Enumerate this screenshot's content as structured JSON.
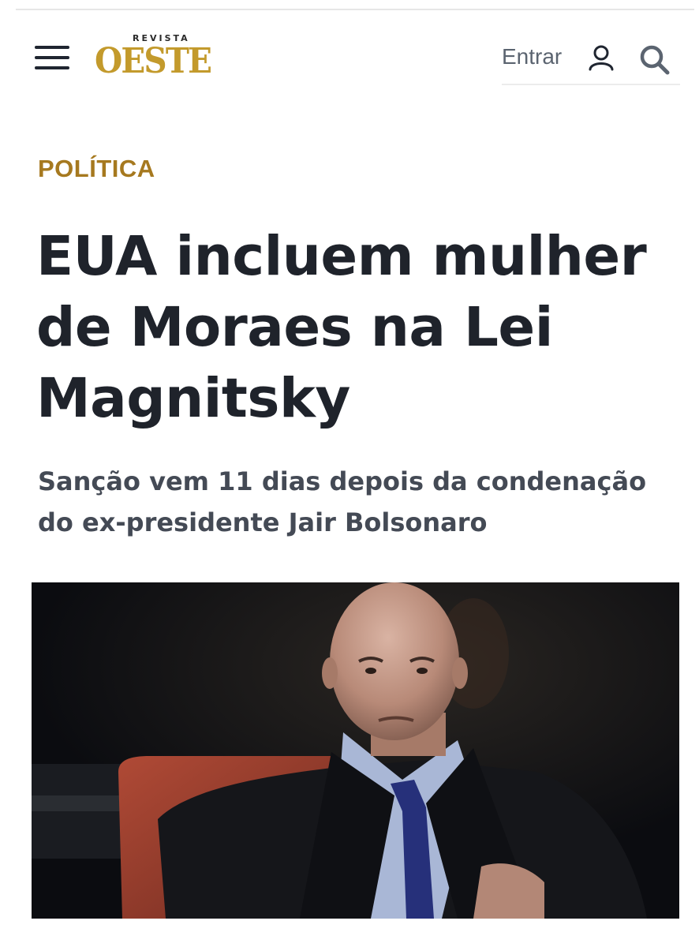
{
  "header": {
    "logo_kicker": "REVISTA",
    "logo_word": "OESTE",
    "signin_label": "Entrar",
    "icons": {
      "menu": "hamburger-menu-icon",
      "user": "user-icon",
      "search": "search-icon"
    }
  },
  "article": {
    "category": "POLÍTICA",
    "headline": "EUA incluem mulher de Moraes na Lei Magnitsky",
    "subtitle": "Sanção vem 11 dias depois da condenação do ex-presidente Jair Bolsonaro"
  },
  "colors": {
    "brand_gold": "#c39a2c",
    "category_gold": "#a6791f",
    "headline": "#1f232b",
    "subtitle": "#444a55"
  }
}
